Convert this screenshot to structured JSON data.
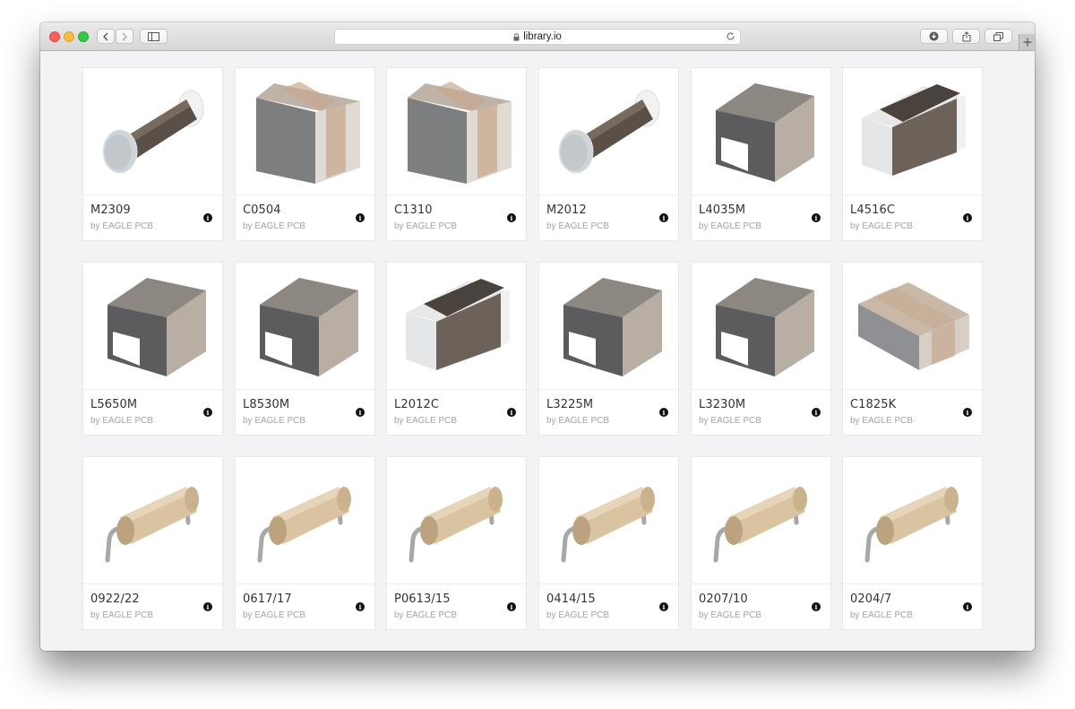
{
  "browser": {
    "url": "library.io"
  },
  "colors": {
    "page_background": "#f2f3f5",
    "card_background": "#ffffff",
    "author_text": "#a3a3a3",
    "ceramic": "#c8a88f",
    "resistor_body": "#d9c3a0"
  },
  "components": [
    {
      "name": "M2309",
      "author": "by EAGLE PCB",
      "icon": "melf-resistor-icon"
    },
    {
      "name": "C0504",
      "author": "by EAGLE PCB",
      "icon": "ceramic-capacitor-icon"
    },
    {
      "name": "C1310",
      "author": "by EAGLE PCB",
      "icon": "ceramic-capacitor-icon"
    },
    {
      "name": "M2012",
      "author": "by EAGLE PCB",
      "icon": "melf-resistor-icon"
    },
    {
      "name": "L4035M",
      "author": "by EAGLE PCB",
      "icon": "molded-inductor-icon"
    },
    {
      "name": "L4516C",
      "author": "by EAGLE PCB",
      "icon": "chip-inductor-icon"
    },
    {
      "name": "L5650M",
      "author": "by EAGLE PCB",
      "icon": "molded-inductor-icon"
    },
    {
      "name": "L8530M",
      "author": "by EAGLE PCB",
      "icon": "molded-inductor-icon"
    },
    {
      "name": "L2012C",
      "author": "by EAGLE PCB",
      "icon": "chip-inductor-icon"
    },
    {
      "name": "L3225M",
      "author": "by EAGLE PCB",
      "icon": "molded-inductor-icon"
    },
    {
      "name": "L3230M",
      "author": "by EAGLE PCB",
      "icon": "molded-inductor-icon"
    },
    {
      "name": "C1825K",
      "author": "by EAGLE PCB",
      "icon": "flat-capacitor-icon"
    },
    {
      "name": "0922/22",
      "author": "by EAGLE PCB",
      "icon": "axial-resistor-icon"
    },
    {
      "name": "0617/17",
      "author": "by EAGLE PCB",
      "icon": "axial-resistor-icon"
    },
    {
      "name": "P0613/15",
      "author": "by EAGLE PCB",
      "icon": "axial-resistor-icon"
    },
    {
      "name": "0414/15",
      "author": "by EAGLE PCB",
      "icon": "axial-resistor-icon"
    },
    {
      "name": "0207/10",
      "author": "by EAGLE PCB",
      "icon": "axial-resistor-icon"
    },
    {
      "name": "0204/7",
      "author": "by EAGLE PCB",
      "icon": "axial-resistor-icon"
    }
  ]
}
